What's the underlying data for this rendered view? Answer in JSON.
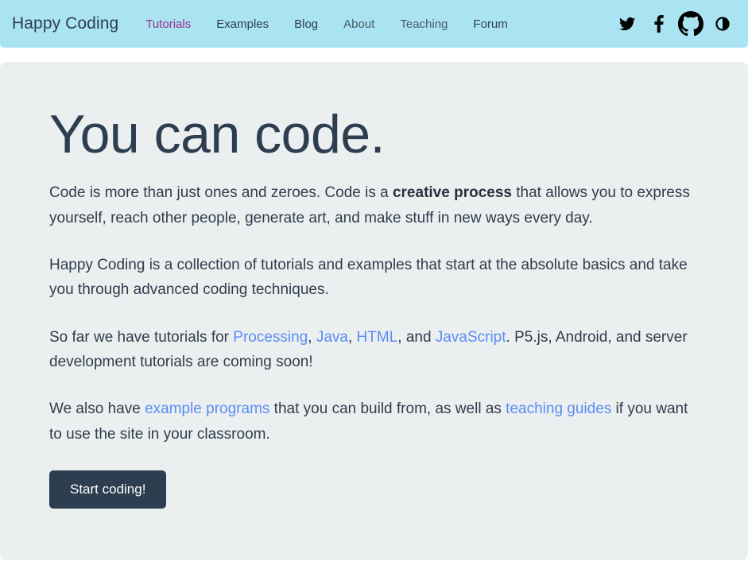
{
  "navbar": {
    "brand": "Happy Coding",
    "background_color": "#aae3f2",
    "links": [
      {
        "label": "Tutorials",
        "state": "visited"
      },
      {
        "label": "Examples",
        "state": "normal"
      },
      {
        "label": "Blog",
        "state": "normal"
      },
      {
        "label": "About",
        "state": "muted"
      },
      {
        "label": "Teaching",
        "state": "muted"
      },
      {
        "label": "Forum",
        "state": "normal"
      }
    ],
    "icons": [
      {
        "name": "twitter-icon",
        "title": "Twitter"
      },
      {
        "name": "facebook-icon",
        "title": "Facebook"
      },
      {
        "name": "github-icon",
        "title": "GitHub"
      },
      {
        "name": "contrast-toggle-icon",
        "title": "Toggle contrast"
      }
    ]
  },
  "hero": {
    "title": "You can code.",
    "title_color": "#2d3e50",
    "background_color": "#eceff0",
    "paragraph1": {
      "part1": "Code is more than just ones and zeroes. Code is a ",
      "bold": "creative process",
      "part2": " that allows you to express yourself, reach other people, generate art, and make stuff in new ways every day."
    },
    "paragraph2": "Happy Coding is a collection of tutorials and examples that start at the absolute basics and take you through advanced coding techniques.",
    "paragraph3": {
      "part1": "So far we have tutorials for ",
      "link1": "Processing",
      "sep1": ", ",
      "link2": "Java",
      "sep2": ", ",
      "link3": "HTML",
      "sep3": ", and ",
      "link4": "JavaScript",
      "part2": ". P5.js, Android, and server development tutorials are coming soon!"
    },
    "paragraph4": {
      "part1": "We also have ",
      "link1": "example programs",
      "part2": " that you can build from, as well as ",
      "link2": "teaching guides",
      "part3": " if you want to use the site in your classroom."
    },
    "cta_label": "Start coding!",
    "cta_background": "#2d3e50",
    "link_color": "#5b8cf5"
  }
}
